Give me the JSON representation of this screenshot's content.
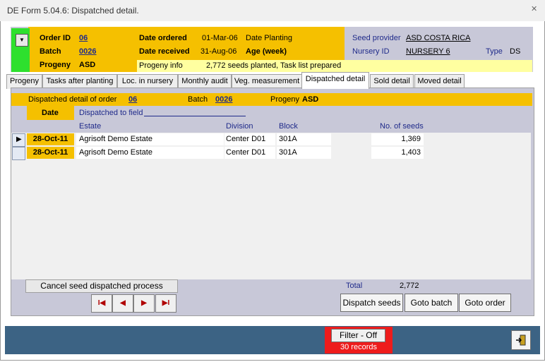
{
  "window": {
    "title": "DE Form 5.04.6: Dispatched detail.",
    "close_glyph": "✕"
  },
  "header": {
    "order_id_label": "Order ID",
    "order_id": "06",
    "batch_label": "Batch",
    "batch": "0026",
    "progeny_label": "Progeny",
    "progeny": "ASD",
    "date_ordered_label": "Date ordered",
    "date_ordered": "01-Mar-06",
    "date_received_label": "Date received",
    "date_received": "31-Aug-06",
    "date_planting_label": "Date Planting",
    "age_label": "Age (week)",
    "seed_provider_label": "Seed provider",
    "seed_provider": "ASD COSTA RICA",
    "nursery_id_label": "Nursery ID",
    "nursery_id": "NURSERY 6",
    "type_label": "Type",
    "type": "DS",
    "progeny_info_label": "Progeny info",
    "progeny_info": "2,772 seeds planted, Task list prepared"
  },
  "tabs": [
    {
      "label": "Progeny"
    },
    {
      "label": "Tasks after planting"
    },
    {
      "label": "Loc. in nursery"
    },
    {
      "label": "Monthly audit"
    },
    {
      "label": "Veg. measurement"
    },
    {
      "label": "Dispatched detail",
      "active": true
    },
    {
      "label": "Sold  detail"
    },
    {
      "label": "Moved detail"
    }
  ],
  "detail": {
    "dispatched_label": "Dispatched detail of order",
    "order": "06",
    "batch_label": "Batch",
    "batch": "0026",
    "progeny_label": "Progeny",
    "progeny": "ASD",
    "columns": {
      "date": "Date",
      "dispatched_to": "Dispatched to field",
      "estate": "Estate",
      "division": "Division",
      "block": "Block",
      "seeds": "No. of seeds"
    },
    "rows": [
      {
        "date": "28-Oct-11",
        "estate": "Agrisoft Demo Estate",
        "division": "Center D01",
        "block": "301A",
        "seeds": "1,369"
      },
      {
        "date": "28-Oct-11",
        "estate": "Agrisoft Demo Estate",
        "division": "Center D01",
        "block": "301A",
        "seeds": "1,403"
      }
    ],
    "total_label": "Total",
    "total": "2,772",
    "cancel_label": "Cancel seed dispatched process"
  },
  "nav": {
    "first": "I◀",
    "prev": "◀",
    "next": "▶",
    "last": "▶I"
  },
  "actions": {
    "dispatch": "Dispatch seeds",
    "goto_batch": "Goto batch",
    "goto_order": "Goto order"
  },
  "footer": {
    "filter_label": "Filter - Off",
    "records": "30 records",
    "exit_glyph": "⇥"
  },
  "colors": {
    "header_yellow": "#f5c000",
    "panel_gray": "#c8c8d8",
    "footer_blue": "#3c6384",
    "filter_red": "#ee1c1c",
    "green": "#2ee02e"
  }
}
